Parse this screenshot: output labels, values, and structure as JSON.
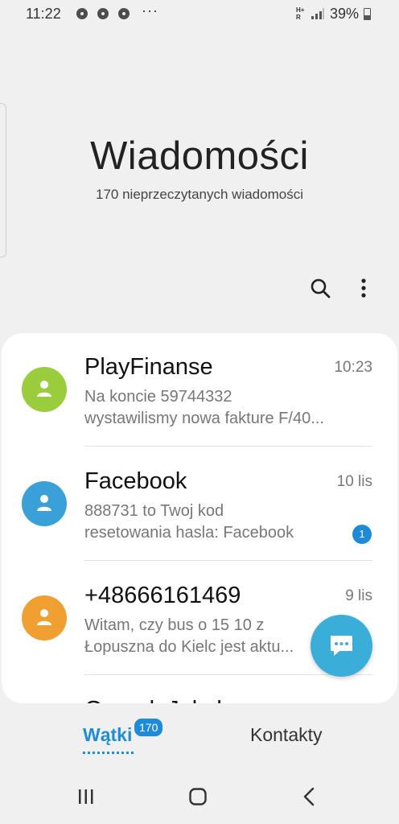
{
  "status_bar": {
    "time": "11:22",
    "more_dots": "···",
    "network_top": "H+",
    "network_bottom": "R",
    "battery": "39%"
  },
  "header": {
    "title": "Wiadomości",
    "subtitle": "170 nieprzeczytanych wiadomości"
  },
  "icons": {
    "search": "search-icon",
    "more": "more-vertical-icon",
    "compose": "chat-bubble-icon"
  },
  "conversations": [
    {
      "name": "PlayFinanse",
      "time": "10:23",
      "preview_line1": "Na koncie 59744332",
      "preview_line2": "wystawilismy nowa fakture F/40...",
      "avatar_color": "#9acd3c",
      "unread": ""
    },
    {
      "name": "Facebook",
      "time": "10 lis",
      "preview_line1": "888731 to Twoj kod",
      "preview_line2": "resetowania hasla: Facebook",
      "avatar_color": "#3aa0d8",
      "unread": "1"
    },
    {
      "name": "+48666161469",
      "time": "9 lis",
      "preview_line1": "Witam, czy bus o 15 10 z",
      "preview_line2": "Łopuszna do Kielc jest aktu...",
      "avatar_color": "#f0a030",
      "unread": ""
    }
  ],
  "partial_row_name": "Garnek Jakub",
  "tabs": {
    "threads_label": "Wątki",
    "threads_badge": "170",
    "contacts_label": "Kontakty"
  },
  "colors": {
    "accent": "#1c8fd4",
    "fab": "#3aaed8",
    "background": "#f0f0f0"
  }
}
